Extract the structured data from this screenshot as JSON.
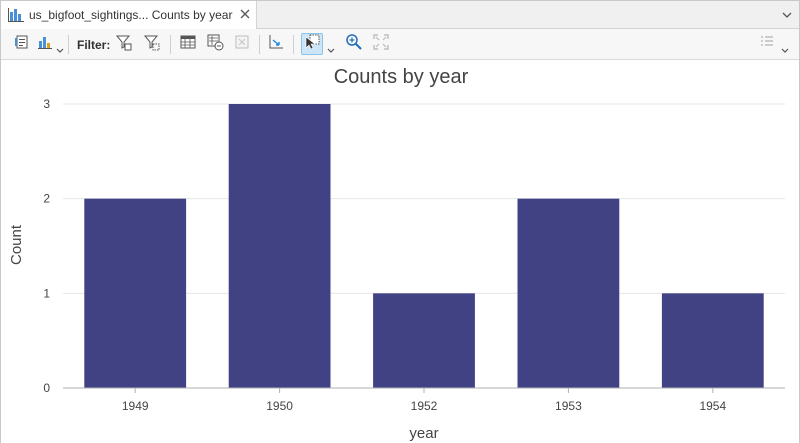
{
  "tab": {
    "title": "us_bigfoot_sightings... Counts by year"
  },
  "toolbar": {
    "filter_label": "Filter:"
  },
  "icons": {
    "tab": "bar-chart-icon",
    "close": "close-icon",
    "overflow": "chevron-down-icon"
  },
  "colors": {
    "bar": "#404284",
    "accent": "#1e88e5",
    "gridline": "#e6e6e6",
    "axis": "#b0b0b0"
  },
  "chart_data": {
    "type": "bar",
    "title": "Counts by year",
    "xlabel": "year",
    "ylabel": "Count",
    "categories": [
      "1949",
      "1950",
      "1952",
      "1953",
      "1954"
    ],
    "values": [
      2,
      3,
      1,
      2,
      1
    ],
    "ylim": [
      0,
      3
    ],
    "yticks": [
      "0",
      "1",
      "2",
      "3"
    ],
    "grid": true,
    "legend": "none"
  }
}
